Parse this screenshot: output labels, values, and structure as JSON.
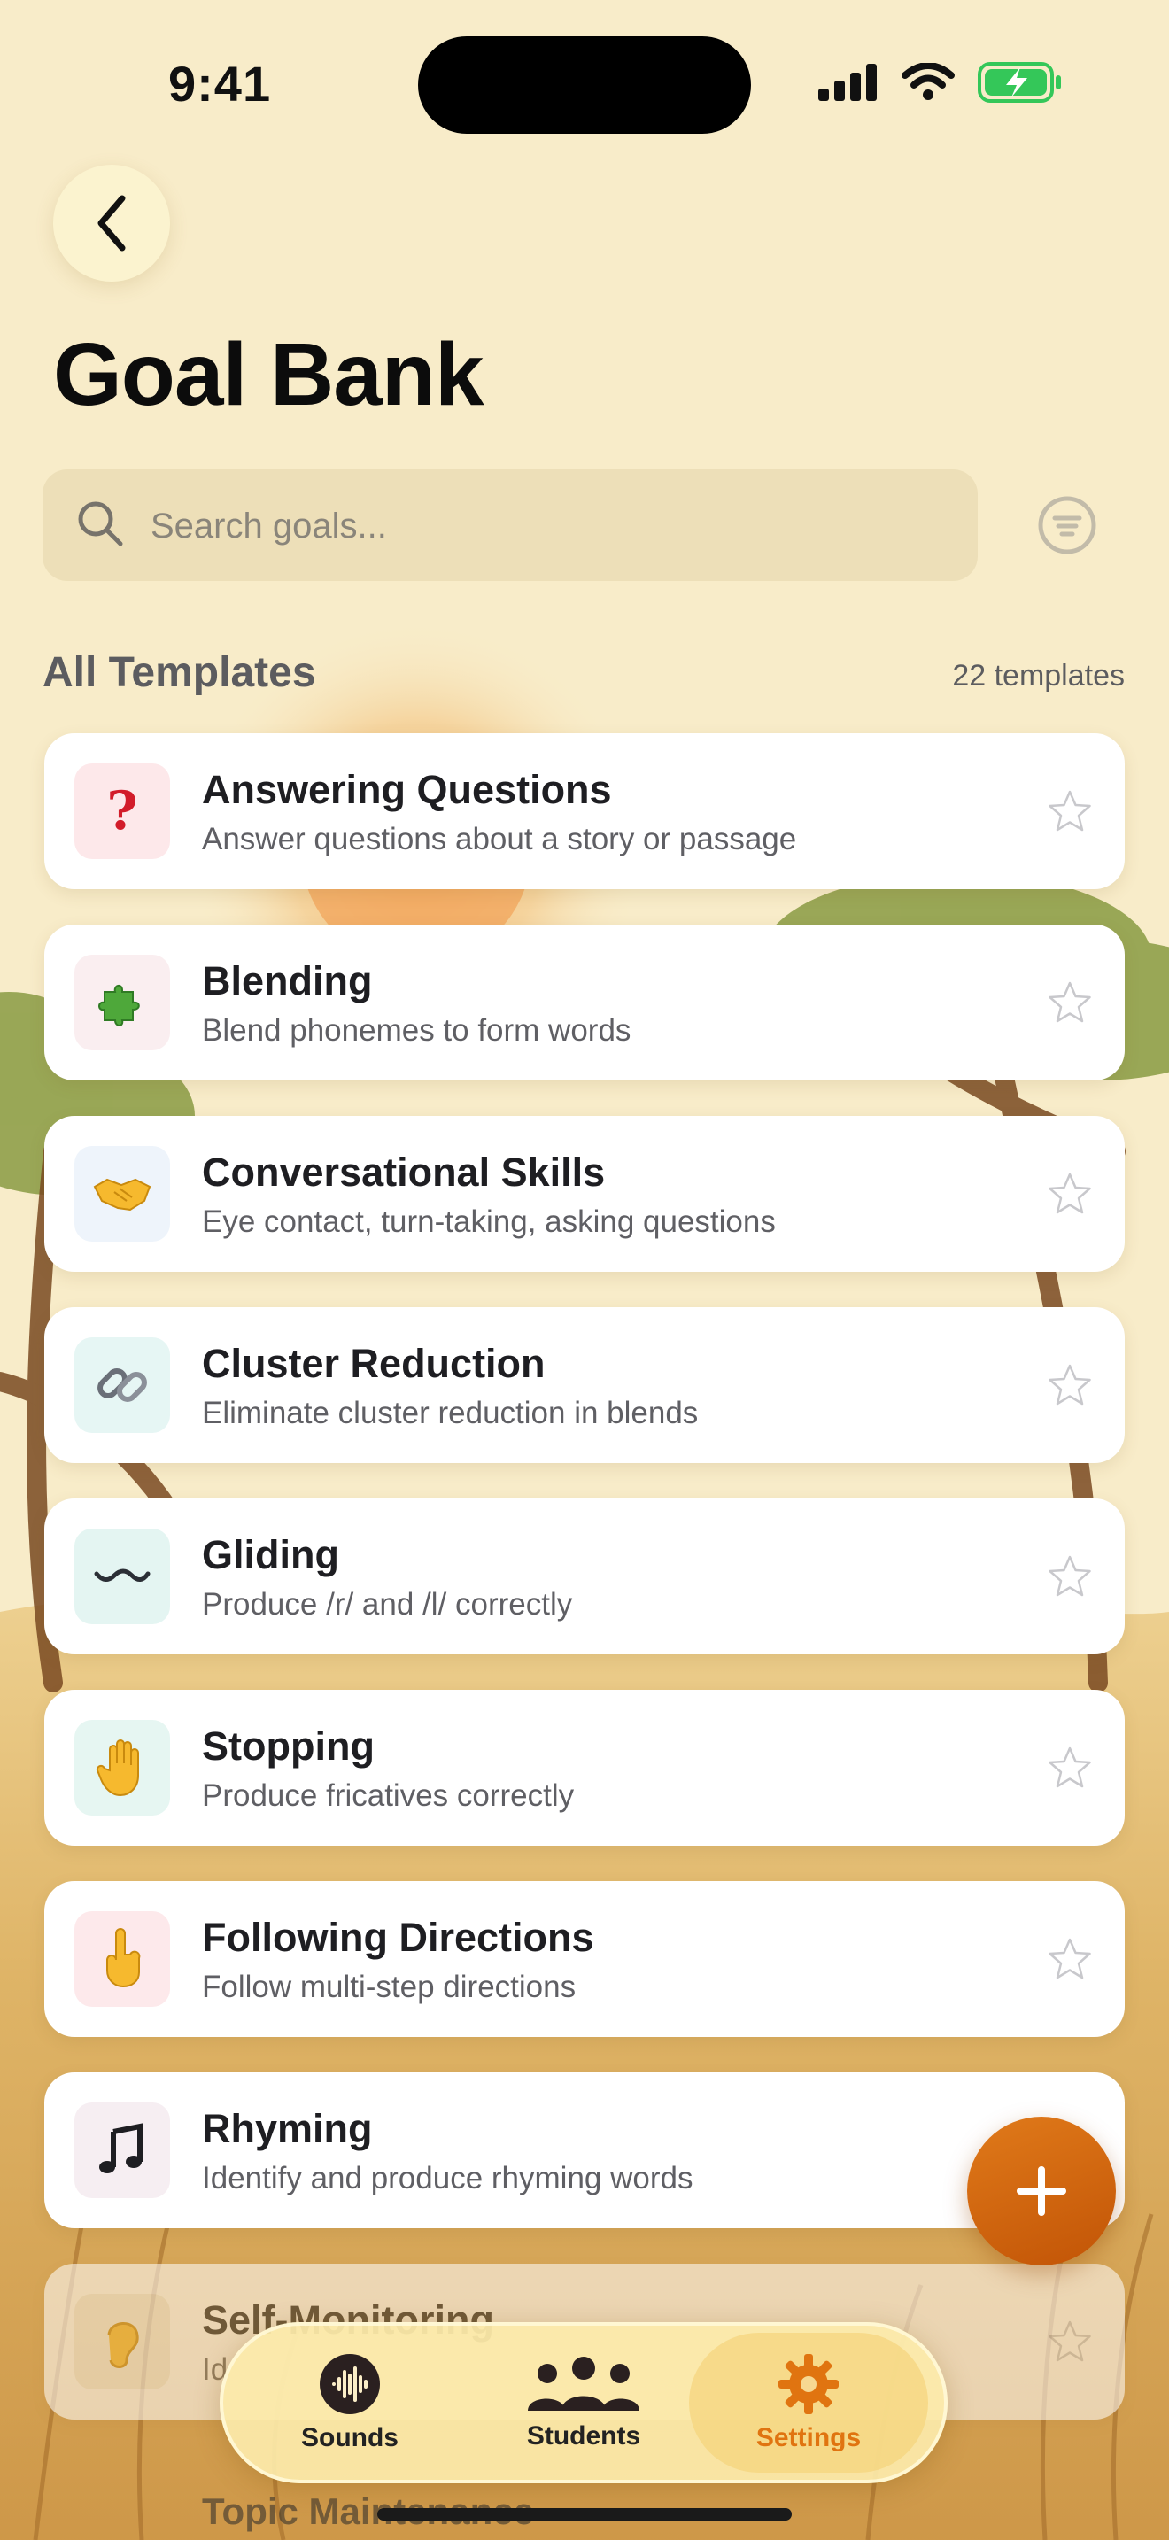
{
  "status": {
    "time": "9:41",
    "battery_color": "#34c759"
  },
  "header": {
    "title": "Goal Bank"
  },
  "search": {
    "placeholder": "Search goals..."
  },
  "section": {
    "title": "All Templates",
    "count": "22 templates"
  },
  "templates": [
    {
      "name": "Answering Questions",
      "desc": "Answer questions about a story or passage",
      "icon": "question-mark-icon",
      "glyph": "❓",
      "icon_bg": "#fde8ea"
    },
    {
      "name": "Blending",
      "desc": "Blend phonemes to form words",
      "icon": "puzzle-piece-icon",
      "glyph": "🧩",
      "icon_bg": "#faeef0"
    },
    {
      "name": "Conversational Skills",
      "desc": "Eye contact, turn-taking, asking questions",
      "icon": "handshake-icon",
      "glyph": "🤝",
      "icon_bg": "#eef4fb"
    },
    {
      "name": "Cluster Reduction",
      "desc": "Eliminate cluster reduction in blends",
      "icon": "chain-link-icon",
      "glyph": "🔗",
      "icon_bg": "#e6f6f4"
    },
    {
      "name": "Gliding",
      "desc": "Produce /r/ and /l/ correctly",
      "icon": "wavy-dash-icon",
      "glyph": "〰",
      "icon_bg": "#e4f5f2"
    },
    {
      "name": "Stopping",
      "desc": "Produce fricatives correctly",
      "icon": "raised-hand-icon",
      "glyph": "✋",
      "icon_bg": "#e6f6f2"
    },
    {
      "name": "Following Directions",
      "desc": "Follow multi-step directions",
      "icon": "pointing-finger-icon",
      "glyph": "👆",
      "icon_bg": "#fde9eb"
    },
    {
      "name": "Rhyming",
      "desc": "Identify and produce rhyming words",
      "icon": "music-notes-icon",
      "glyph": "🎵",
      "icon_bg": "#f6eef2"
    },
    {
      "name": "Self-Monitoring",
      "desc": "Id",
      "icon": "ear-icon",
      "glyph": "👂",
      "icon_bg": "#f3efe4"
    },
    {
      "name": "Topic Maintenance",
      "desc": "",
      "icon": "",
      "glyph": "",
      "icon_bg": ""
    }
  ],
  "tabs": [
    {
      "label": "Sounds",
      "icon": "waveform-icon"
    },
    {
      "label": "Students",
      "icon": "people-icon"
    },
    {
      "label": "Settings",
      "icon": "gear-icon",
      "active": true
    }
  ],
  "colors": {
    "accent": "#e07410",
    "background": "#f8ecc9"
  }
}
